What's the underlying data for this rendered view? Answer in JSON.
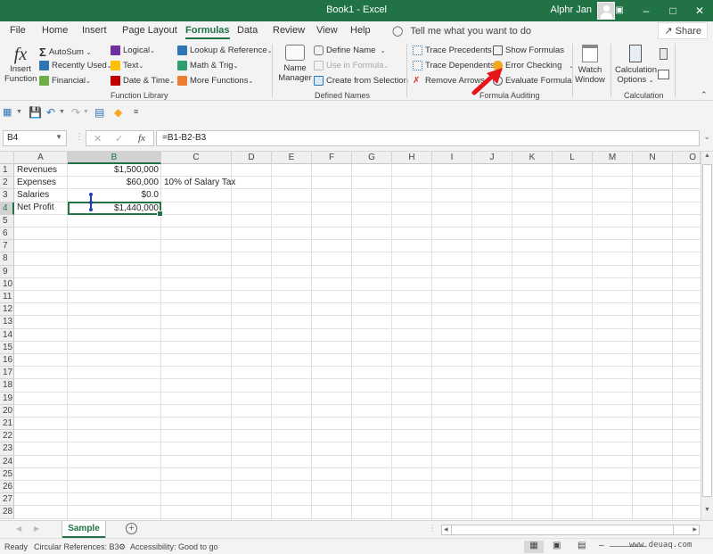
{
  "window": {
    "title": "Book1  -  Excel",
    "user": "Alphr Jan",
    "controls": [
      "ribbon-display",
      "minimize",
      "maximize",
      "close"
    ]
  },
  "menu": {
    "tabs": [
      "File",
      "Home",
      "Insert",
      "Page Layout",
      "Formulas",
      "Data",
      "Review",
      "View",
      "Help"
    ],
    "active": "Formulas",
    "tell_me": "Tell me what you want to do",
    "share": "Share"
  },
  "ribbon": {
    "function_library": {
      "label": "Function Library",
      "insert_function": [
        "Insert",
        "Function"
      ],
      "items": [
        {
          "label": "AutoSum",
          "icon": "sigma-icon",
          "color": "#333333"
        },
        {
          "label": "Recently Used",
          "icon": "star-book-icon",
          "color": "#2e75b6"
        },
        {
          "label": "Financial",
          "icon": "financial-book-icon",
          "color": "#70ad47"
        },
        {
          "label": "Logical",
          "icon": "logical-book-icon",
          "color": "#7030a0"
        },
        {
          "label": "Text",
          "icon": "text-book-icon",
          "color": "#ffc000"
        },
        {
          "label": "Date & Time",
          "icon": "datetime-book-icon",
          "color": "#c00000"
        },
        {
          "label": "Lookup & Reference",
          "icon": "lookup-book-icon",
          "color": "#2e75b6"
        },
        {
          "label": "Math & Trig",
          "icon": "math-book-icon",
          "color": "#2f9e6e"
        },
        {
          "label": "More Functions",
          "icon": "more-functions-book-icon",
          "color": "#ed7d31"
        }
      ]
    },
    "defined_names": {
      "label": "Defined Names",
      "name_manager": [
        "Name",
        "Manager"
      ],
      "define_name": "Define Name",
      "use_in_formula": "Use in Formula",
      "create_from_selection": "Create from Selection"
    },
    "formula_auditing": {
      "label": "Formula Auditing",
      "trace_precedents": "Trace Precedents",
      "trace_dependents": "Trace Dependents",
      "remove_arrows": "Remove Arrows",
      "show_formulas": "Show Formulas",
      "error_checking": "Error Checking",
      "evaluate_formula": "Evaluate Formula",
      "watch_window": [
        "Watch",
        "Window"
      ]
    },
    "calculation": {
      "label": "Calculation",
      "calculation_options": [
        "Calculation",
        "Options"
      ]
    }
  },
  "formula_bar": {
    "name_box": "B4",
    "formula": "=B1-B2-B3",
    "fx": "fx"
  },
  "sheet": {
    "columns": [
      "A",
      "B",
      "C",
      "D",
      "E",
      "F",
      "G",
      "H",
      "I",
      "J",
      "K",
      "L",
      "M",
      "N",
      "O"
    ],
    "rows": [
      "1",
      "2",
      "3",
      "4",
      "5",
      "6",
      "7",
      "8",
      "9",
      "10",
      "11",
      "12",
      "13",
      "14",
      "15",
      "16",
      "17",
      "18",
      "19",
      "20",
      "21",
      "22",
      "23",
      "24",
      "25",
      "26",
      "27",
      "28"
    ],
    "selected_cell": "B4",
    "cells": {
      "A1": "Revenues",
      "B1": "$1,500,000",
      "A2": "Expenses",
      "B2": "$60,000",
      "C2": "10% of Salary Tax",
      "A3": "Salaries",
      "B3": "$0.0",
      "A4": "Net Profit",
      "B4": "$1,440,000"
    }
  },
  "sheet_tabs": {
    "tabs": [
      "Sample"
    ],
    "active": "Sample"
  },
  "status": {
    "ready": "Ready",
    "circular": "Circular References: B3",
    "accessibility": "Accessibility: Good to go",
    "watermark": "www.deuaq.com"
  },
  "colors": {
    "brand": "#217346",
    "annotation_arrow": "#e8161b",
    "trace_arrow": "#1f3fb8"
  }
}
